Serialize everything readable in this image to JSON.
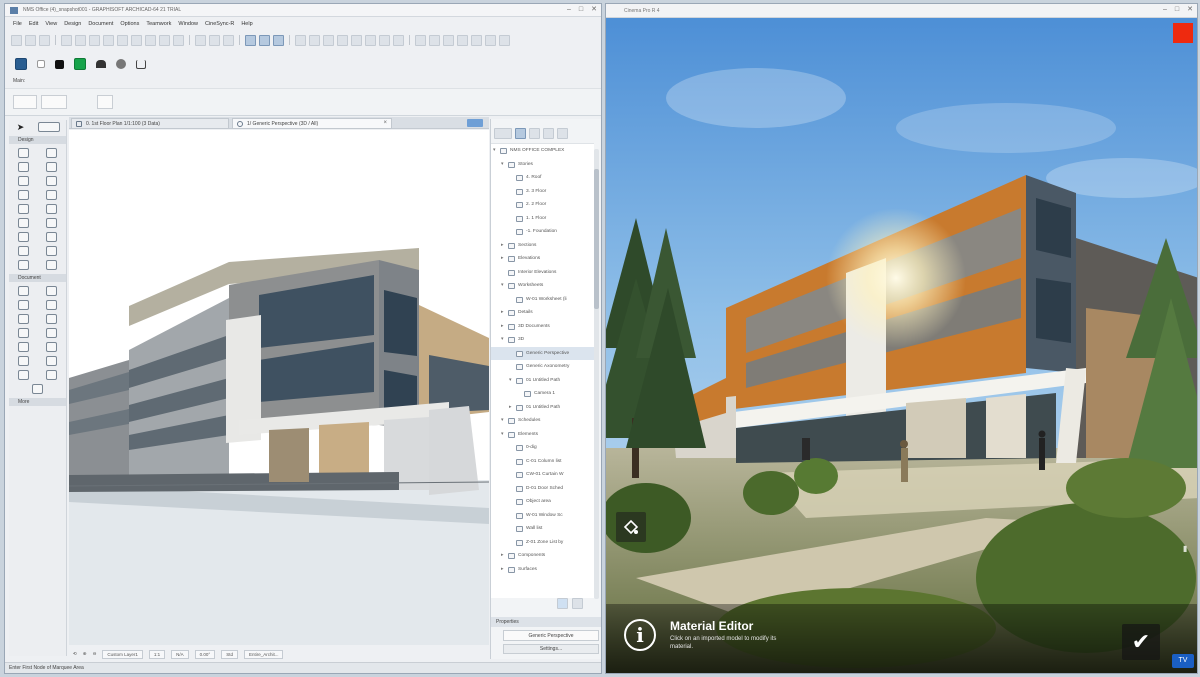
{
  "left_window": {
    "title": "NMS Office (4)_snapshot001 - GRAPHISOFT ARCHICAD-64 21 TRIAL",
    "menu": [
      "File",
      "Edit",
      "View",
      "Design",
      "Document",
      "Options",
      "Teamwork",
      "Window",
      "CineSync-R",
      "Help"
    ],
    "mode_label": "Main:",
    "toolbox": {
      "sections": [
        {
          "label": "Design"
        },
        {
          "label": "Document"
        },
        {
          "label": "More"
        }
      ]
    },
    "tabs": [
      {
        "label": "0. 1st Floor Plan 1/1:100 (3 Data)"
      },
      {
        "label": "1/ Generic Perspective (3D / All)"
      }
    ],
    "navigator": {
      "tree": [
        {
          "label": "NMS OFFICE COMPLEX",
          "level": 0
        },
        {
          "label": "Stories",
          "level": 1
        },
        {
          "label": "4. Roof",
          "level": 2
        },
        {
          "label": "3. 3 Floor",
          "level": 2
        },
        {
          "label": "2. 2 Floor",
          "level": 2
        },
        {
          "label": "1. 1 Floor",
          "level": 2
        },
        {
          "label": "-1. Foundation",
          "level": 2
        },
        {
          "label": "Sections",
          "level": 1
        },
        {
          "label": "Elevations",
          "level": 1
        },
        {
          "label": "Interior Elevations",
          "level": 1
        },
        {
          "label": "Worksheets",
          "level": 1
        },
        {
          "label": "W-01 Worksheet (li",
          "level": 2
        },
        {
          "label": "Details",
          "level": 1
        },
        {
          "label": "3D Documents",
          "level": 1
        },
        {
          "label": "3D",
          "level": 1
        },
        {
          "label": "Generic Perspective",
          "level": 2,
          "selected": true
        },
        {
          "label": "Generic Axonometry",
          "level": 2
        },
        {
          "label": "01 Untitled Path",
          "level": 2
        },
        {
          "label": "Camera 1",
          "level": 3
        },
        {
          "label": "01 Untitled Path",
          "level": 2
        },
        {
          "label": "Schedules",
          "level": 1
        },
        {
          "label": "Elements",
          "level": 1
        },
        {
          "label": "0-dig",
          "level": 2
        },
        {
          "label": "C-01 Column list",
          "level": 2
        },
        {
          "label": "CW-01 Curtain W",
          "level": 2
        },
        {
          "label": "D-01 Door Sched",
          "level": 2
        },
        {
          "label": "Object area",
          "level": 2
        },
        {
          "label": "W-01 Window Sc",
          "level": 2
        },
        {
          "label": "Wall list",
          "level": 2
        },
        {
          "label": "Z-01 Zone List by",
          "level": 2
        },
        {
          "label": "Components",
          "level": 1
        },
        {
          "label": "Surfaces",
          "level": 1
        }
      ],
      "properties_label": "Properties",
      "properties_name": "Generic Perspective",
      "settings_label": "Settings..."
    },
    "view_status": {
      "scale": "1:1",
      "zoom": "N/A",
      "angle": "0.00°",
      "pen_set": "Std",
      "model": "Entire_Archit...",
      "layer": "Custom Layer1"
    },
    "status_bar": "Enter First Node of Marquee Area"
  },
  "right_window": {
    "title": "Cinema Pro R 4",
    "material_editor": {
      "title": "Material Editor",
      "description": "Click on an imported model to modify its material."
    },
    "confirm_glyph": "✔",
    "corner_badge": "TV"
  }
}
